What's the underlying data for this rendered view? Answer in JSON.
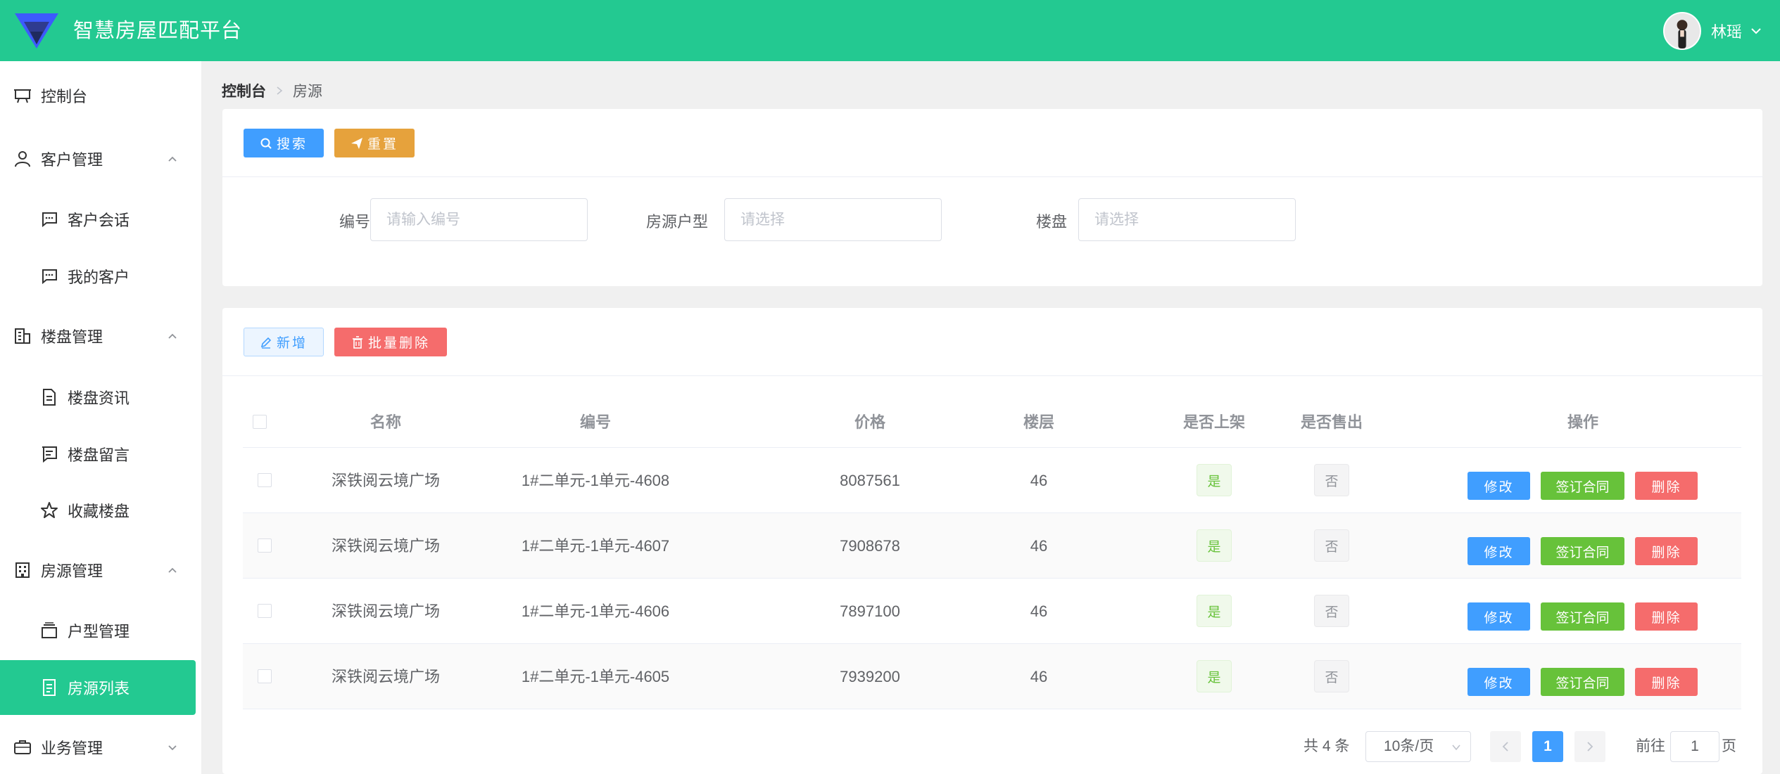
{
  "header": {
    "title": "智慧房屋匹配平台",
    "username": "林瑶",
    "colors": {
      "brand": "#23c991"
    }
  },
  "sidebar": {
    "items": [
      {
        "label": "控制台",
        "icon": "presentation-icon",
        "level": "top"
      },
      {
        "label": "客户管理",
        "icon": "user-icon",
        "level": "top",
        "expanded": true
      },
      {
        "label": "客户会话",
        "icon": "chat-icon",
        "level": "sub"
      },
      {
        "label": "我的客户",
        "icon": "chat-icon",
        "level": "sub"
      },
      {
        "label": "楼盘管理",
        "icon": "building-icon",
        "level": "top",
        "expanded": true
      },
      {
        "label": "楼盘资讯",
        "icon": "document-icon",
        "level": "sub"
      },
      {
        "label": "楼盘留言",
        "icon": "message-icon",
        "level": "sub"
      },
      {
        "label": "收藏楼盘",
        "icon": "star-icon",
        "level": "sub"
      },
      {
        "label": "房源管理",
        "icon": "office-icon",
        "level": "top",
        "expanded": true
      },
      {
        "label": "户型管理",
        "icon": "box-icon",
        "level": "sub"
      },
      {
        "label": "房源列表",
        "icon": "list-icon",
        "level": "sub",
        "active": true
      },
      {
        "label": "业务管理",
        "icon": "briefcase-icon",
        "level": "top",
        "expanded": false
      }
    ]
  },
  "breadcrumb": {
    "home": "控制台",
    "current": "房源"
  },
  "search": {
    "search_label": "搜索",
    "reset_label": "重置",
    "fields": [
      {
        "label": "编号",
        "placeholder": "请输入编号"
      },
      {
        "label": "房源户型",
        "placeholder": "请选择"
      },
      {
        "label": "楼盘",
        "placeholder": "请选择"
      }
    ]
  },
  "toolbar": {
    "add_label": "新增",
    "batch_delete_label": "批量删除"
  },
  "table": {
    "columns": [
      "名称",
      "编号",
      "价格",
      "楼层",
      "是否上架",
      "是否售出",
      "操作"
    ],
    "rows": [
      {
        "name": "深铁阅云境广场",
        "code": "1#二单元-1单元-4608",
        "price": "8087561",
        "floor": "46",
        "listed": "是",
        "sold": "否"
      },
      {
        "name": "深铁阅云境广场",
        "code": "1#二单元-1单元-4607",
        "price": "7908678",
        "floor": "46",
        "listed": "是",
        "sold": "否"
      },
      {
        "name": "深铁阅云境广场",
        "code": "1#二单元-1单元-4606",
        "price": "7897100",
        "floor": "46",
        "listed": "是",
        "sold": "否"
      },
      {
        "name": "深铁阅云境广场",
        "code": "1#二单元-1单元-4605",
        "price": "7939200",
        "floor": "46",
        "listed": "是",
        "sold": "否"
      }
    ],
    "actions": {
      "edit": "修改",
      "sign": "签订合同",
      "delete": "删除"
    }
  },
  "pagination": {
    "total_text": "共 4 条",
    "page_size": "10条/页",
    "current_page": "1",
    "goto_label": "前往",
    "goto_value": "1",
    "page_suffix": "页"
  }
}
